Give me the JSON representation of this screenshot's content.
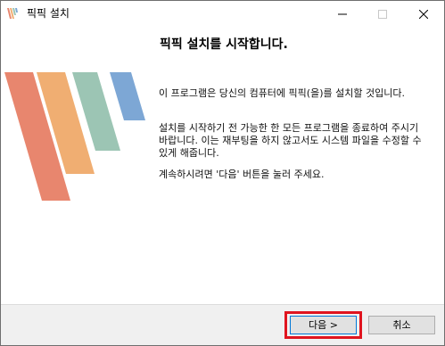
{
  "window": {
    "title": "픽픽 설치"
  },
  "main": {
    "heading": "픽픽 설치를 시작합니다.",
    "paragraph1": "이 프로그램은 당신의 컴퓨터에 픽픽(을)를 설치할 것입니다.",
    "paragraph2": "설치를 시작하기 전 가능한 한 모든 프로그램을 종료하여 주시기 바랍니다. 이는 재부팅을 하지 않고서도 시스템 파일을 수정할 수 있게 해줍니다.",
    "paragraph3": "계속하시려면 '다음' 버튼을 눌러 주세요."
  },
  "footer": {
    "next_label": "다음 >",
    "cancel_label": "취소"
  },
  "colors": {
    "stripe_red": "#e8866e",
    "stripe_orange": "#f0ae72",
    "stripe_green": "#9cc5b4",
    "stripe_blue": "#7da7d5",
    "highlight": "#e0141f"
  }
}
